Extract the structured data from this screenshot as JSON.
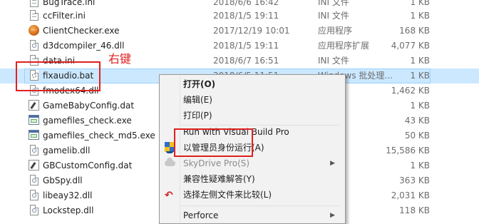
{
  "files": [
    {
      "name": "BugTrace.ini",
      "date": "2018/6/6 16:42",
      "type": "INI 文件",
      "size": "1 KB",
      "icon": "ini-file-icon"
    },
    {
      "name": "ccFilter.ini",
      "date": "2018/1/5 19:11",
      "type": "INI 文件",
      "size": "1 KB",
      "icon": "ini-file-icon"
    },
    {
      "name": "ClientChecker.exe",
      "date": "2017/12/19 10:01",
      "type": "应用程序",
      "size": "168 KB",
      "icon": "orb-exe-icon"
    },
    {
      "name": "d3dcompiler_46.dll",
      "date": "2018/1/5 19:11",
      "type": "应用程序扩展",
      "size": "4,077 KB",
      "icon": "dll-file-icon"
    },
    {
      "name": "data.ini",
      "date": "2018/6/7 16:51",
      "type": "INI 文件",
      "size": "1 KB",
      "icon": "ini-file-icon"
    },
    {
      "name": "fixaudio.bat",
      "date": "2018/6/5 11:51",
      "type": "Windows 批处理...",
      "size": "1 KB",
      "icon": "bat-file-icon"
    },
    {
      "name": "fmodex64.dll",
      "date": "",
      "type": "",
      "size": "1,462 KB",
      "icon": "dll-file-icon"
    },
    {
      "name": "GameBabyConfig.dat",
      "date": "",
      "type": "",
      "size": "1 KB",
      "icon": "dat-file-icon"
    },
    {
      "name": "gamefiles_check.exe",
      "date": "",
      "type": "",
      "size": "43 KB",
      "icon": "window-exe-icon"
    },
    {
      "name": "gamefiles_check_md5.exe",
      "date": "",
      "type": "",
      "size": "50 KB",
      "icon": "window-exe-icon"
    },
    {
      "name": "gamelib.dll",
      "date": "",
      "type": "",
      "size": "15,586 KB",
      "icon": "dll-file-icon"
    },
    {
      "name": "GBCustomConfig.dat",
      "date": "",
      "type": "",
      "size": "1 KB",
      "icon": "dat-file-icon"
    },
    {
      "name": "GbSpy.dll",
      "date": "",
      "type": "",
      "size": "363 KB",
      "icon": "dll-file-icon"
    },
    {
      "name": "libeay32.dll",
      "date": "",
      "type": "",
      "size": "2,031 KB",
      "icon": "dll-file-icon"
    },
    {
      "name": "Lockstep.dll",
      "date": "",
      "type": "",
      "size": "118 KB",
      "icon": "dll-file-icon"
    }
  ],
  "annotations": {
    "right_click_label": "右键"
  },
  "context_menu": {
    "items": [
      {
        "label": "打开(O)",
        "bold": true
      },
      {
        "label": "编辑(E)"
      },
      {
        "label": "打印(P)"
      },
      {
        "label": "Run with Visual Build Pro"
      },
      {
        "label": "以管理员身份运行(A)",
        "icon": "uac-shield-icon"
      },
      {
        "label": "SkyDrive Pro(S)",
        "disabled": true,
        "submenu": true,
        "icon": "cloud-icon"
      },
      {
        "label": "兼容性疑难解答(Y)"
      },
      {
        "label": "选择左侧文件来比较(L)",
        "icon": "compare-arrow-icon"
      },
      {
        "label": "Perforce",
        "submenu": true
      }
    ],
    "submenu_arrow": "▶",
    "undo_arrow_glyph": "↶"
  },
  "colors": {
    "selection_bg": "#cce8ff",
    "annotation_red": "#e02020",
    "menu_bg": "#f2f2f2"
  }
}
